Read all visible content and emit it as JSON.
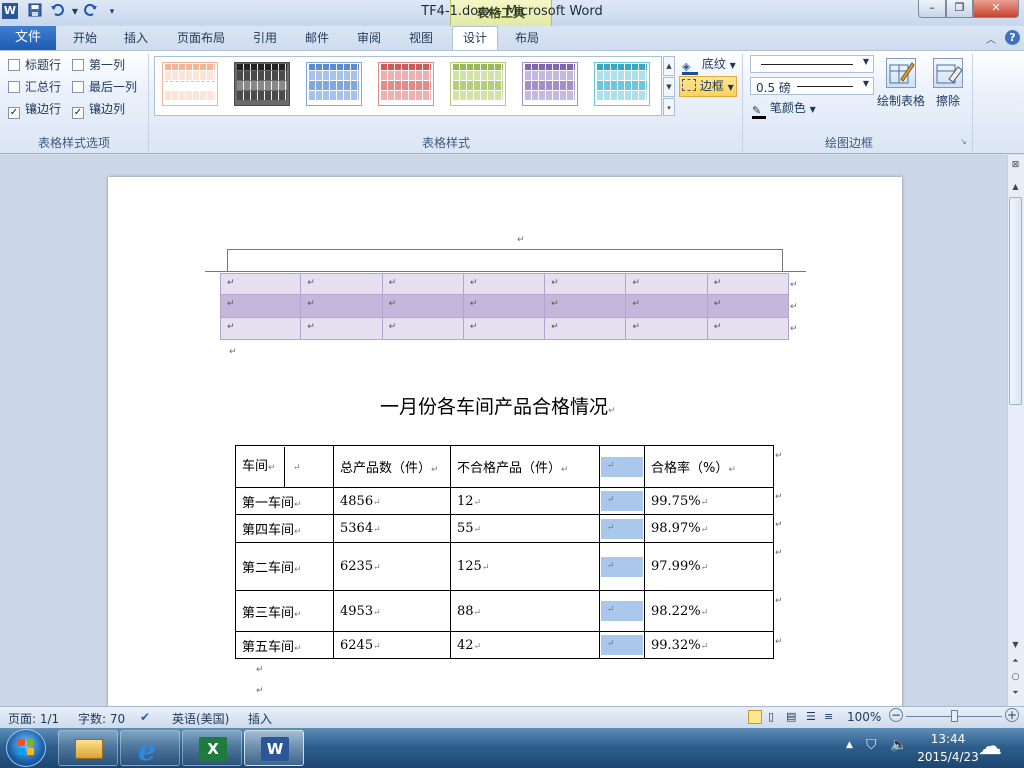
{
  "window": {
    "title": "TF4-1.docx  -  Microsoft Word",
    "context_tab_group": "表格工具",
    "quick_access": {
      "app_icon": "W",
      "save_icon": "save-icon",
      "undo_icon": "undo-icon",
      "redo_icon": "redo-icon",
      "customize_icon": "customize-icon"
    },
    "controls": {
      "minimize": "–",
      "restore": "❐",
      "close": "✕"
    }
  },
  "ribbon_tabs": [
    {
      "label": "文件"
    },
    {
      "label": "开始"
    },
    {
      "label": "插入"
    },
    {
      "label": "页面布局"
    },
    {
      "label": "引用"
    },
    {
      "label": "邮件"
    },
    {
      "label": "审阅"
    },
    {
      "label": "视图"
    },
    {
      "label": "设计",
      "active": true
    },
    {
      "label": "布局"
    }
  ],
  "ribbon": {
    "style_options": {
      "group_label": "表格样式选项",
      "checkboxes": [
        {
          "label": "标题行",
          "checked": false
        },
        {
          "label": "第一列",
          "checked": false
        },
        {
          "label": "汇总行",
          "checked": false
        },
        {
          "label": "最后一列",
          "checked": false
        },
        {
          "label": "镶边行",
          "checked": true
        },
        {
          "label": "镶边列",
          "checked": true
        }
      ]
    },
    "table_styles": {
      "group_label": "表格样式",
      "swatch_colors": [
        "#f3b59a",
        "#4a4a4a",
        "#7fa6dd",
        "#e58a8a",
        "#b5cf78",
        "#a48fcb",
        "#6ec6d8"
      ],
      "shading_label": "底纹",
      "borders_label": "边框"
    },
    "draw_borders": {
      "group_label": "绘图边框",
      "pen_weight": "0.5 磅",
      "pen_color_label": "笔颜色",
      "draw_table_label": "绘制表格",
      "eraser_label": "擦除"
    }
  },
  "document": {
    "paragraph_mark": "↵",
    "title": "一月份各车间产品合格情况",
    "table": {
      "header": [
        "车间",
        "总产品数（件）",
        "不合格产品（件）",
        "合格率（%）"
      ],
      "rows": [
        [
          "第一车间",
          "4856",
          "12",
          "99.75%"
        ],
        [
          "第四车间",
          "5364",
          "55",
          "98.97%"
        ],
        [
          "第二车间",
          "6235",
          "125",
          "97.99%"
        ],
        [
          "第三车间",
          "4953",
          "88",
          "98.22%"
        ],
        [
          "第五车间",
          "6245",
          "42",
          "99.32%"
        ]
      ]
    },
    "decorative_table": {
      "band_light": "#e6dff0",
      "band_dark": "#c5b7dc",
      "border": "#b6a4cf"
    }
  },
  "status_bar": {
    "page": "页面: 1/1",
    "word_count": "字数: 70",
    "language": "英语(美国)",
    "insert_mode": "插入",
    "zoom": "100%"
  },
  "taskbar": {
    "time": "13:44",
    "date": "2015/4/23",
    "apps": [
      "explorer",
      "internet-explorer",
      "excel",
      "word"
    ]
  }
}
